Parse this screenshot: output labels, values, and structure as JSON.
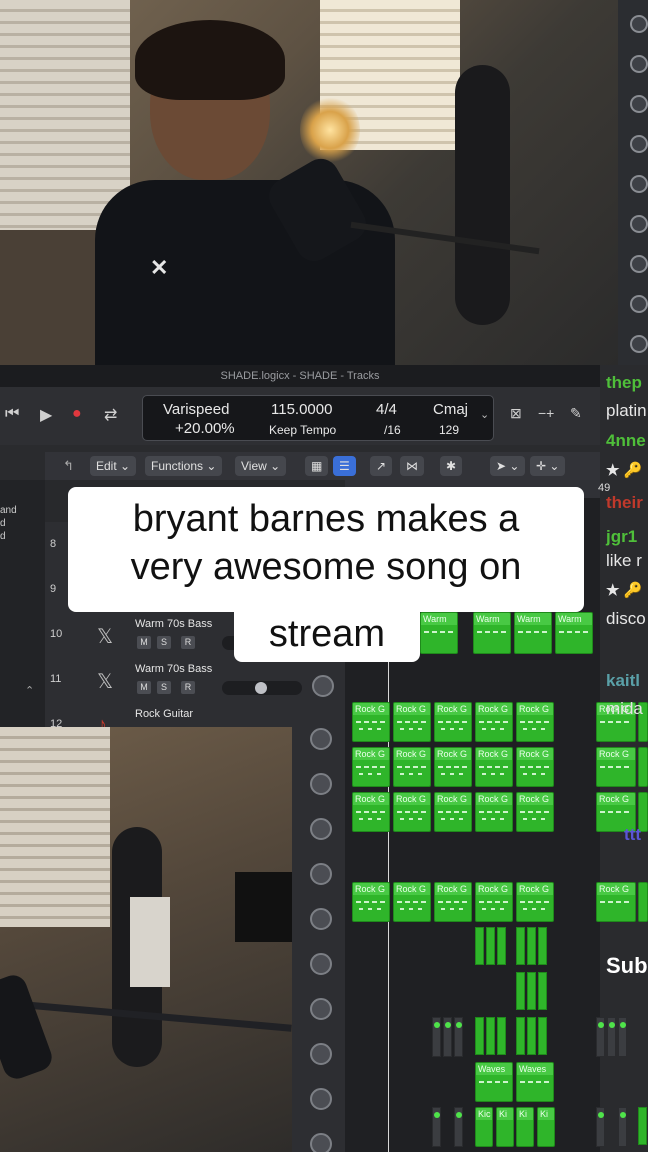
{
  "caption": {
    "line1": "bryant barnes makes a",
    "line2": "very awesome song on",
    "line3": "stream"
  },
  "daw": {
    "window_title": "SHADE.logicx - SHADE - Tracks",
    "lcd": {
      "varispeed_label": "Varispeed",
      "varispeed_value": "+20.00%",
      "tempo": "115.0000",
      "tempo_mode": "Keep Tempo",
      "time_sig_top": "4/4",
      "time_sig_bottom": "/16",
      "key": "Cmaj",
      "key_value": "129"
    },
    "toolbar": {
      "edit": "Edit",
      "functions": "Functions",
      "view": "View"
    },
    "ruler_bar": "49",
    "left_labels": [
      "and",
      "d",
      "d"
    ],
    "tracks": [
      {
        "num": "8",
        "name": ""
      },
      {
        "num": "9",
        "name": ""
      },
      {
        "num": "10",
        "name": "Warm 70s Bass"
      },
      {
        "num": "11",
        "name": "Warm 70s Bass"
      },
      {
        "num": "12",
        "name": "Rock Guitar"
      }
    ],
    "msr": [
      "M",
      "S",
      "R"
    ],
    "region_labels": {
      "warm": "Warm",
      "rock": "Rock G",
      "waves": "Waves",
      "kick": "Kic",
      "ki": "Ki"
    }
  },
  "chat": {
    "lines": [
      {
        "text": "thep",
        "color": "#4fbf3a"
      },
      {
        "text": "platin",
        "color": "#e6e6e6"
      },
      {
        "text": "4nne",
        "color": "#4fbf3a"
      },
      {
        "text": "★ 🔑",
        "color": "#e6e6e6"
      },
      {
        "text": "their",
        "color": "#c0392b"
      },
      {
        "text": "jgr1",
        "color": "#4fbf3a"
      },
      {
        "text": "like r",
        "color": "#e6e6e6"
      },
      {
        "text": "★ 🔑",
        "color": "#e6e6e6"
      },
      {
        "text": "disco",
        "color": "#e6e6e6"
      },
      {
        "text": "kaitl",
        "color": "#5aa0a8"
      },
      {
        "text": "mida",
        "color": "#e6e6e6"
      },
      {
        "text": "ttt",
        "color": "#5a55d6"
      },
      {
        "text": "Sub",
        "color": "#ffffff"
      }
    ]
  }
}
